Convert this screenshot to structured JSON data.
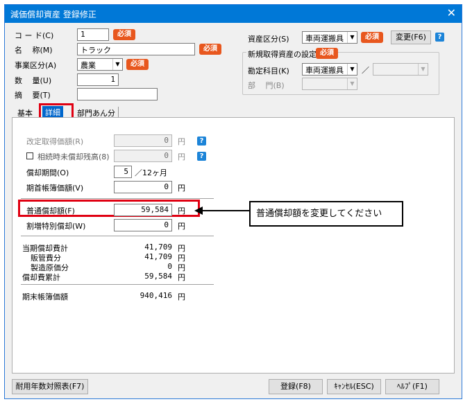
{
  "window": {
    "title": "減価償却資産 登録修正",
    "close_glyph": "✕"
  },
  "form": {
    "code_label": "コ ー ド(C)",
    "code_value": "1",
    "name_label": "名 　称(M)",
    "name_value": "トラック",
    "business_label": "事業区分(A)",
    "business_value": "農業",
    "quantity_label": "数 　量(U)",
    "quantity_value": "1",
    "summary_label": "摘 　要(T)",
    "summary_value": "",
    "required_badge": "必須"
  },
  "asset_class": {
    "label": "資産区分(S)",
    "value": "車両運搬具",
    "change_button": "変更(F6)"
  },
  "new_asset": {
    "title": "新規取得資産の設定",
    "account_label": "勘定科目(K)",
    "account_value": "車両運搬具",
    "account_separator": "／",
    "dept_label": "部 　門(B)"
  },
  "tabs": [
    {
      "label": "基本"
    },
    {
      "label": "詳細"
    },
    {
      "label": "部門あん分"
    }
  ],
  "detail": {
    "revised_cost_label": "改定取得価額(R)",
    "revised_cost_value": "0",
    "inherited_label": "相続時未償却残高(8)",
    "inherited_value": "0",
    "period_label": "償却期間(O)",
    "period_value": "5",
    "period_unit": "／12ヶ月",
    "opening_book_label": "期首帳簿価額(V)",
    "opening_book_value": "0",
    "normal_dep_label": "普通償却額(F)",
    "normal_dep_value": "59,584",
    "special_dep_label": "割増特別償却(W)",
    "special_dep_value": "0",
    "yen": "円",
    "current_dep_label": "当期償却費計",
    "current_dep_value": "41,709",
    "selling_label": "販管費分",
    "selling_value": "41,709",
    "manufacturing_label": "製造原価分",
    "manufacturing_value": "0",
    "accumulated_label": "償却費累計",
    "accumulated_value": "59,584",
    "closing_book_label": "期末帳簿価額",
    "closing_book_value": "940,416"
  },
  "callout_text": "普通償却額を変更してください",
  "footer": {
    "life_table_button": "耐用年数対照表(F7)",
    "register_button": "登録(F8)",
    "cancel_button": "ｷｬﾝｾﾙ(ESC)",
    "help_button": "ﾍﾙﾌﾟ(F1)"
  },
  "help_glyph": "?",
  "dropdown_glyph": "▼",
  "colors": {
    "title_bar": "#0078d7",
    "required_badge": "#e8571e",
    "highlight_box": "#e00012",
    "active_tab": "#0066cc"
  }
}
